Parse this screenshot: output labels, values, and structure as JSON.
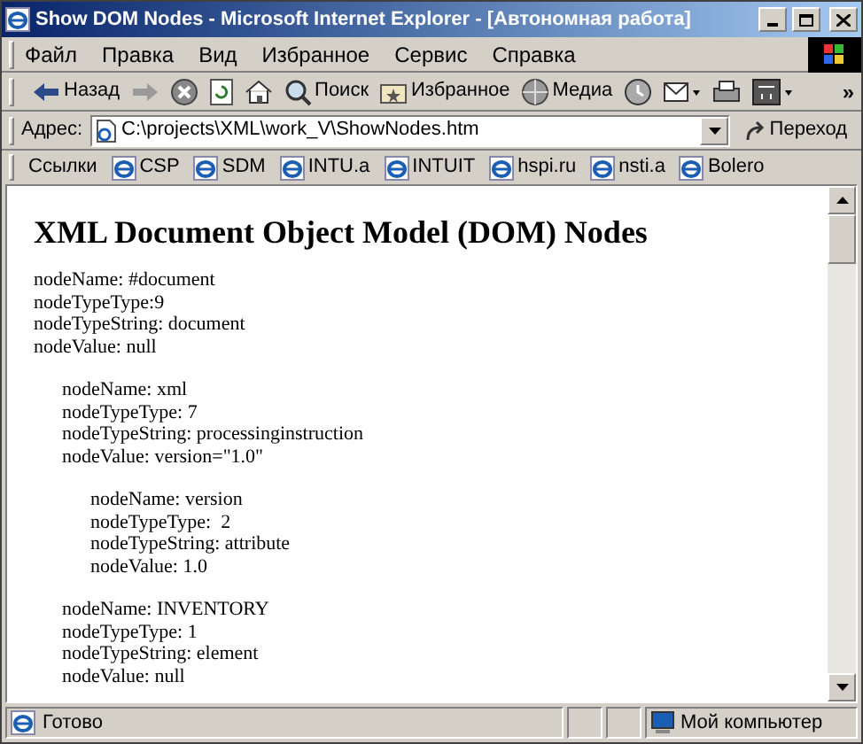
{
  "window": {
    "title": "Show DOM Nodes - Microsoft Internet Explorer - [Автономная работа]"
  },
  "menu": [
    "Файл",
    "Правка",
    "Вид",
    "Избранное",
    "Сервис",
    "Справка"
  ],
  "toolbar": [
    {
      "kind": "back",
      "label": "Назад",
      "disabled": false
    },
    {
      "kind": "forward",
      "disabled": true
    },
    {
      "kind": "stop"
    },
    {
      "kind": "refresh"
    },
    {
      "kind": "home"
    },
    {
      "kind": "search",
      "label": "Поиск",
      "disabled": false
    },
    {
      "kind": "favorites",
      "label": "Избранное",
      "disabled": false
    },
    {
      "kind": "media",
      "label": "Медиа",
      "disabled": false
    },
    {
      "kind": "history"
    },
    {
      "kind": "mail"
    },
    {
      "kind": "print"
    },
    {
      "kind": "edit"
    }
  ],
  "toolbar_more": "»",
  "address": {
    "label": "Адрес:",
    "value": "C:\\projects\\XML\\work_V\\ShowNodes.htm",
    "go": "Переход"
  },
  "links": {
    "label": "Ссылки",
    "items": [
      "CSP",
      "SDM",
      "INTU.a",
      "INTUIT",
      "hspi.ru",
      "nsti.a",
      "Bolero"
    ]
  },
  "content": {
    "heading": "XML Document Object Model (DOM) Nodes",
    "nodes": [
      {
        "lines": [
          "nodeName: #document",
          "nodeTypeType:9",
          "nodeTypeString: document",
          "nodeValue: null"
        ],
        "children": [
          {
            "lines": [
              "nodeName: xml",
              "nodeTypeType: 7",
              "nodeTypeString: processinginstruction",
              "nodeValue: version=\"1.0\""
            ],
            "children": [
              {
                "lines": [
                  "nodeName: version",
                  "nodeTypeType:  2",
                  "nodeTypeString: attribute",
                  "nodeValue: 1.0"
                ]
              }
            ]
          },
          {
            "lines": [
              "nodeName: INVENTORY",
              "nodeTypeType: 1",
              "nodeTypeString: element",
              "nodeValue: null"
            ]
          }
        ]
      }
    ]
  },
  "status_bar": {
    "text": "Готово",
    "zone": "Мой компьютер"
  }
}
